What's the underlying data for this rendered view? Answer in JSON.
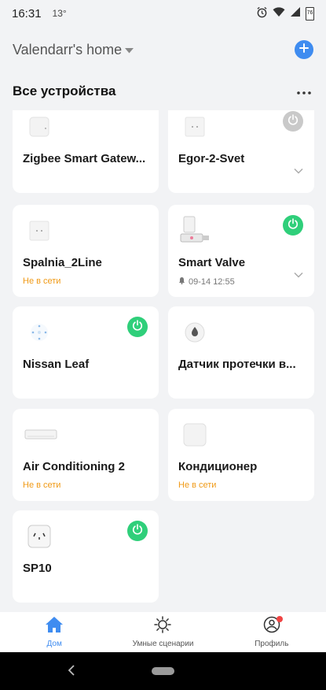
{
  "status_bar": {
    "time": "16:31",
    "temperature": "13°",
    "battery": "76",
    "icons": [
      "alarm-icon",
      "wifi-icon",
      "signal-icon",
      "battery-icon"
    ]
  },
  "header": {
    "home_name": "Valendarr's home",
    "add_icon": "plus-icon",
    "accent": "#3f8cf0"
  },
  "section": {
    "title": "Все устройства",
    "more_icon": "more-horizontal-icon"
  },
  "devices": [
    {
      "name": "Zigbee Smart Gatew...",
      "status": "",
      "power": "none",
      "icon": "gateway-icon"
    },
    {
      "name": "Egor-2-Svet",
      "status": "",
      "power": "off",
      "expand": true,
      "icon": "switch-icon"
    },
    {
      "name": "Spalnia_2Line",
      "status": "Не в сети",
      "power": "none",
      "icon": "switch-icon"
    },
    {
      "name": "Smart Valve",
      "status": "09-14 12:55",
      "power": "on",
      "expand": true,
      "icon": "valve-icon"
    },
    {
      "name": "Nissan Leaf",
      "status": "",
      "power": "on",
      "icon": "car-charger-icon"
    },
    {
      "name": "Датчик протечки в...",
      "status": "",
      "power": "none",
      "icon": "water-leak-sensor-icon"
    },
    {
      "name": "Air Conditioning 2",
      "status": "Не в сети",
      "power": "none",
      "icon": "air-conditioner-icon"
    },
    {
      "name": "Кондиционер",
      "status": "Не в сети",
      "power": "none",
      "icon": "remote-hub-icon"
    },
    {
      "name": "SP10",
      "status": "",
      "power": "on",
      "icon": "smart-plug-icon"
    }
  ],
  "colors": {
    "online_power": "#2fcf7a",
    "offline_power": "#c9c9c9",
    "offline_text": "#f09a16"
  },
  "tabs": [
    {
      "label": "Дом",
      "icon": "home-icon",
      "active": true
    },
    {
      "label": "Умные сценарии",
      "icon": "sun-icon",
      "active": false
    },
    {
      "label": "Профиль",
      "icon": "user-icon",
      "active": false,
      "badge": true
    }
  ]
}
